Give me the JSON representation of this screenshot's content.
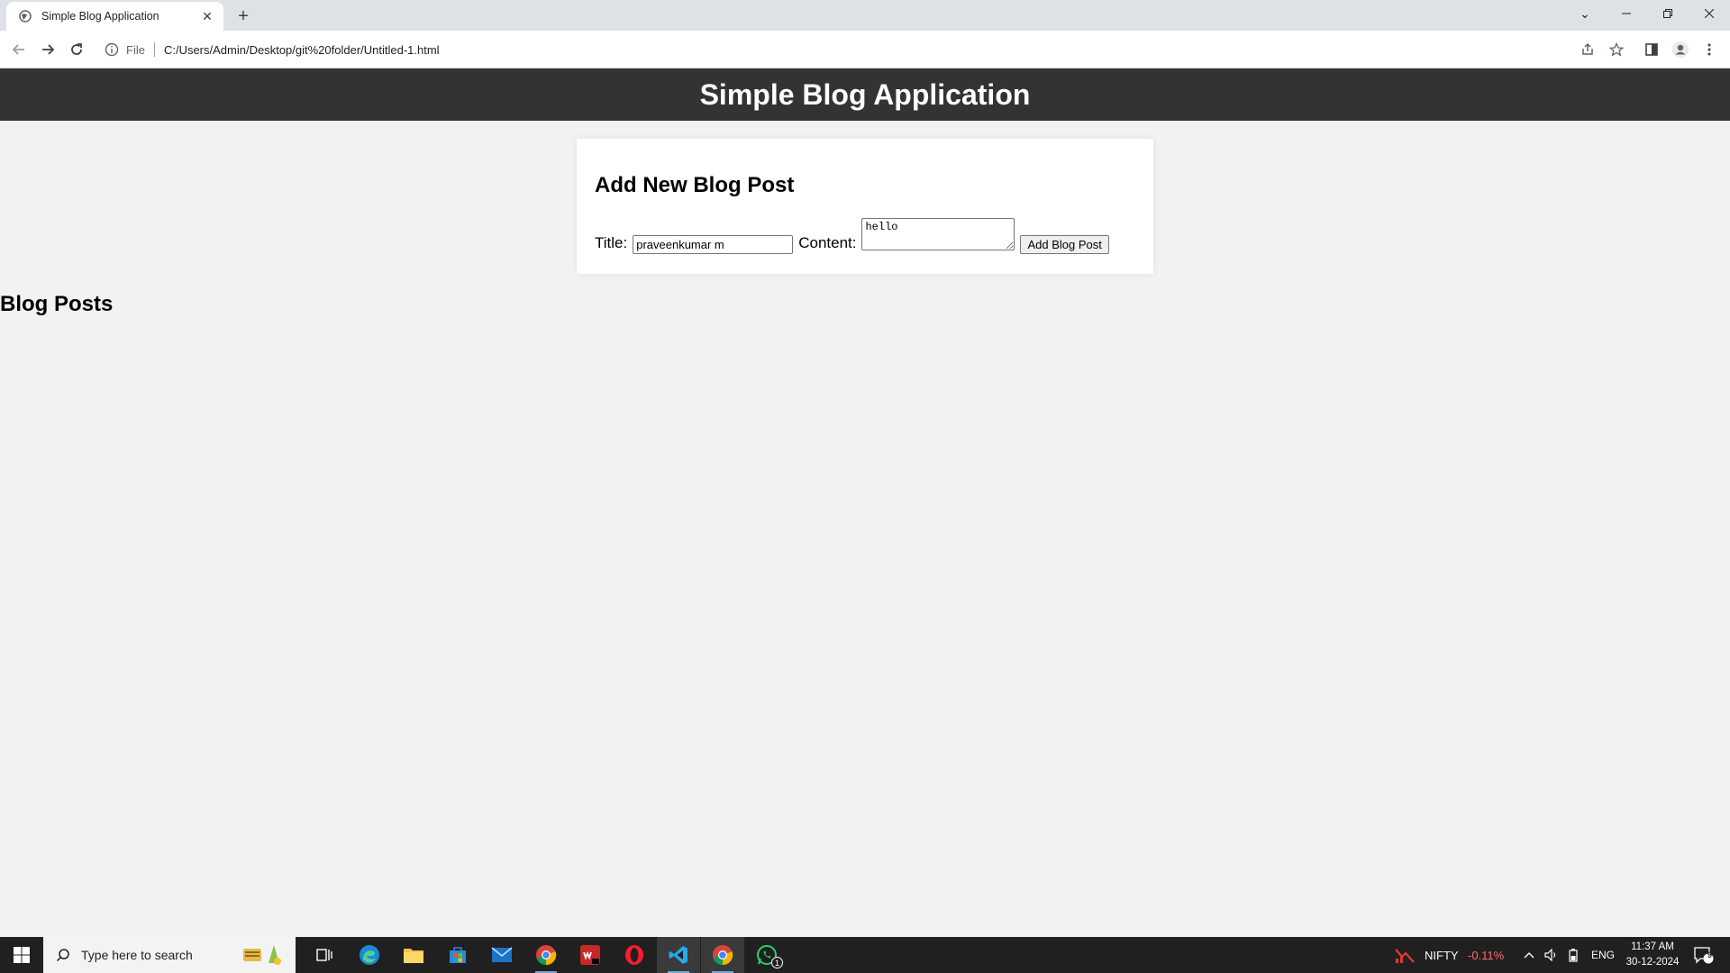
{
  "browser": {
    "tab_title": "Simple Blog Application",
    "scheme_label": "File",
    "url": "C:/Users/Admin/Desktop/git%20folder/Untitled-1.html"
  },
  "site": {
    "header_title": "Simple Blog Application",
    "form_heading": "Add New Blog Post",
    "title_label": "Title:",
    "title_value": "praveenkumar m",
    "content_label": "Content:",
    "content_value": "hello",
    "add_button_label": "Add Blog Post",
    "posts_heading": "Blog Posts"
  },
  "taskbar": {
    "search_placeholder": "Type here to search",
    "stock_name": "NIFTY",
    "stock_change": "-0.11%",
    "language": "ENG",
    "time": "11:37 AM",
    "date": "30-12-2024",
    "notification_count": "9",
    "whatsapp_badge": "1"
  },
  "colors": {
    "header_bg": "#333333",
    "page_bg": "#f2f2f2",
    "stock_negative": "#ff6b6b"
  }
}
